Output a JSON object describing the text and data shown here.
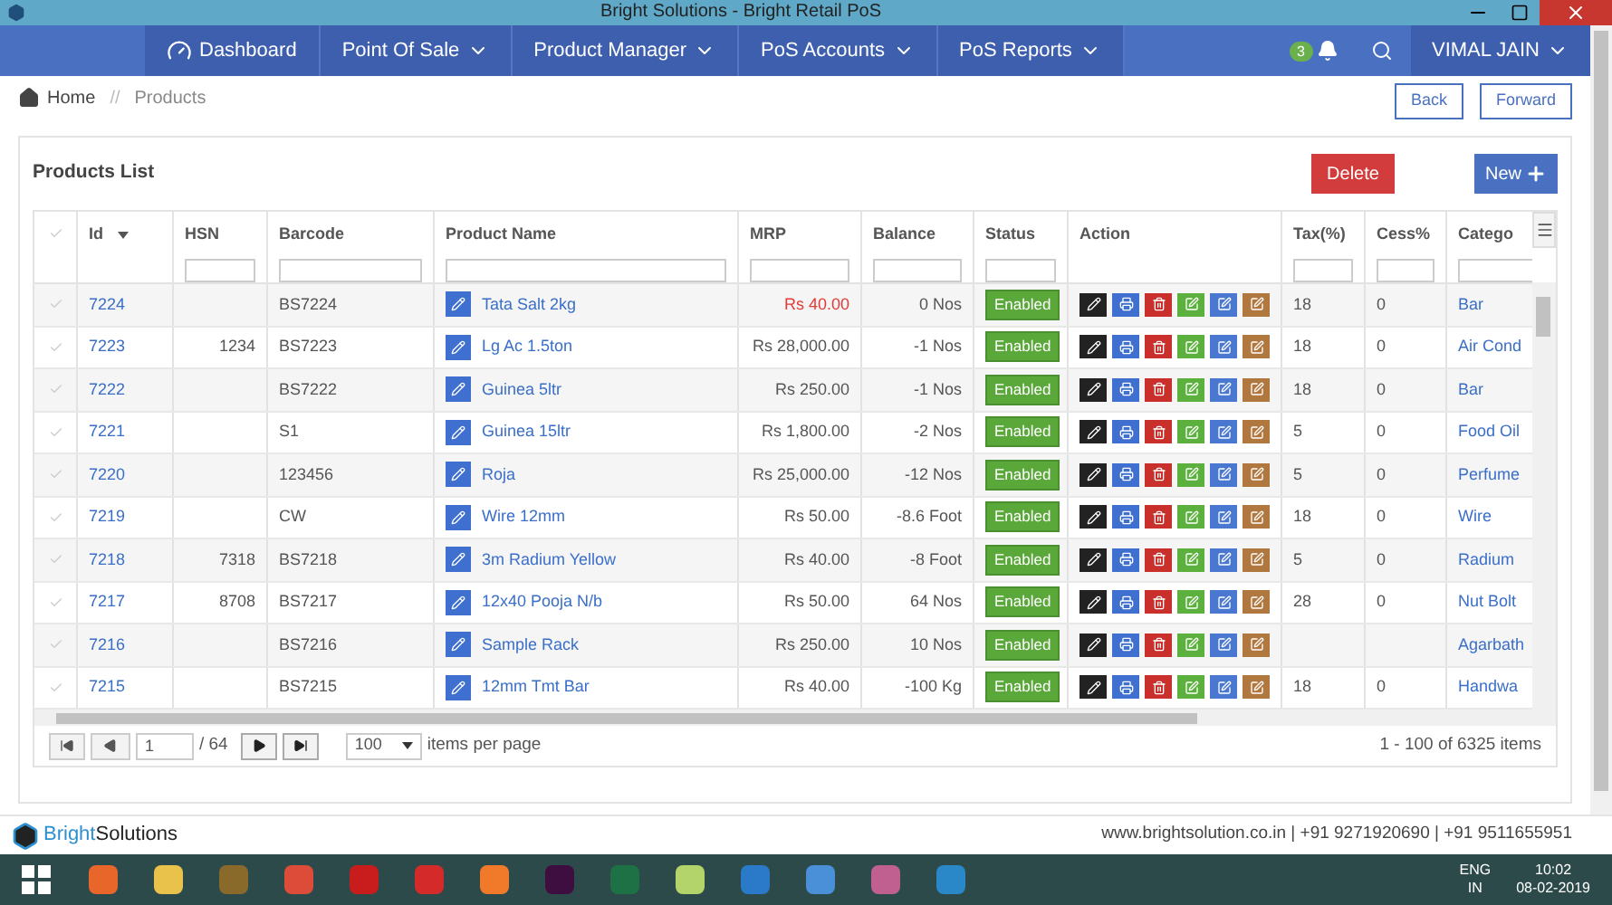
{
  "window": {
    "title": "Bright Solutions - Bright Retail PoS"
  },
  "nav": {
    "items": [
      {
        "label": "Dashboard",
        "kind": "icon"
      },
      {
        "label": "Point Of Sale",
        "kind": "dropdown"
      },
      {
        "label": "Product Manager",
        "kind": "dropdown"
      },
      {
        "label": "PoS Accounts",
        "kind": "dropdown"
      },
      {
        "label": "PoS Reports",
        "kind": "dropdown"
      }
    ],
    "notification_count": "3",
    "user": "VIMAL JAIN"
  },
  "breadcrumb": {
    "items": [
      "Home",
      "Products"
    ],
    "separator": "//"
  },
  "page_buttons": [
    "Back",
    "Forward"
  ],
  "card": {
    "title": "Products List",
    "delete_button": "Delete",
    "new_button": "New"
  },
  "table": {
    "columns": [
      {
        "label": "Id",
        "sorted": true,
        "filter": false
      },
      {
        "label": "HSN",
        "sorted": false,
        "filter": true
      },
      {
        "label": "Barcode",
        "sorted": false,
        "filter": true
      },
      {
        "label": "Product Name",
        "sorted": false,
        "filter": true
      },
      {
        "label": "MRP",
        "sorted": false,
        "filter": true
      },
      {
        "label": "Balance",
        "sorted": false,
        "filter": true
      },
      {
        "label": "Status",
        "sorted": false,
        "filter": true
      },
      {
        "label": "Action",
        "sorted": false,
        "filter": false
      },
      {
        "label": "Tax(%)",
        "sorted": false,
        "filter": true
      },
      {
        "label": "Cess%",
        "sorted": false,
        "filter": true
      },
      {
        "label": "Catego",
        "sorted": false,
        "filter": true
      }
    ],
    "actions": [
      {
        "kind": "pencil",
        "color": "#222222"
      },
      {
        "kind": "print",
        "color": "#3f6fcf"
      },
      {
        "kind": "trash",
        "color": "#c9302c"
      },
      {
        "kind": "edit",
        "color": "#5cb13e"
      },
      {
        "kind": "edit",
        "color": "#4a78d0"
      },
      {
        "kind": "edit",
        "color": "#b0773f"
      }
    ],
    "rows": [
      {
        "id": "7224",
        "hsn": "",
        "barcode": "BS7224",
        "name": "Tata Salt 2kg",
        "mrp": "Rs 40.00",
        "mrp_alert": true,
        "balance": "0 Nos",
        "status": "Enabled",
        "tax": "18",
        "cess": "0",
        "category": "Bar"
      },
      {
        "id": "7223",
        "hsn": "1234",
        "barcode": "BS7223",
        "name": "Lg Ac 1.5ton",
        "mrp": "Rs 28,000.00",
        "mrp_alert": false,
        "balance": "-1 Nos",
        "status": "Enabled",
        "tax": "18",
        "cess": "0",
        "category": "Air Cond"
      },
      {
        "id": "7222",
        "hsn": "",
        "barcode": "BS7222",
        "name": "Guinea 5ltr",
        "mrp": "Rs 250.00",
        "mrp_alert": false,
        "balance": "-1 Nos",
        "status": "Enabled",
        "tax": "18",
        "cess": "0",
        "category": "Bar"
      },
      {
        "id": "7221",
        "hsn": "",
        "barcode": "S1",
        "name": "Guinea 15ltr",
        "mrp": "Rs 1,800.00",
        "mrp_alert": false,
        "balance": "-2 Nos",
        "status": "Enabled",
        "tax": "5",
        "cess": "0",
        "category": "Food Oil"
      },
      {
        "id": "7220",
        "hsn": "",
        "barcode": "123456",
        "name": "Roja",
        "mrp": "Rs 25,000.00",
        "mrp_alert": false,
        "balance": "-12 Nos",
        "status": "Enabled",
        "tax": "5",
        "cess": "0",
        "category": "Perfume"
      },
      {
        "id": "7219",
        "hsn": "",
        "barcode": "CW",
        "name": "Wire 12mm",
        "mrp": "Rs 50.00",
        "mrp_alert": false,
        "balance": "-8.6 Foot",
        "status": "Enabled",
        "tax": "18",
        "cess": "0",
        "category": "Wire"
      },
      {
        "id": "7218",
        "hsn": "7318",
        "barcode": "BS7218",
        "name": "3m Radium Yellow",
        "mrp": "Rs 40.00",
        "mrp_alert": false,
        "balance": "-8 Foot",
        "status": "Enabled",
        "tax": "5",
        "cess": "0",
        "category": "Radium"
      },
      {
        "id": "7217",
        "hsn": "8708",
        "barcode": "BS7217",
        "name": "12x40 Pooja N/b",
        "mrp": "Rs 50.00",
        "mrp_alert": false,
        "balance": "64 Nos",
        "status": "Enabled",
        "tax": "28",
        "cess": "0",
        "category": "Nut Bolt"
      },
      {
        "id": "7216",
        "hsn": "",
        "barcode": "BS7216",
        "name": "Sample Rack",
        "mrp": "Rs 250.00",
        "mrp_alert": false,
        "balance": "10 Nos",
        "status": "Enabled",
        "tax": "",
        "cess": "",
        "category": "Agarbath"
      },
      {
        "id": "7215",
        "hsn": "",
        "barcode": "BS7215",
        "name": "12mm Tmt Bar",
        "mrp": "Rs 40.00",
        "mrp_alert": false,
        "balance": "-100 Kg",
        "status": "Enabled",
        "tax": "18",
        "cess": "0",
        "category": "Handwa"
      }
    ]
  },
  "pager": {
    "page": "1",
    "pages": "/ 64",
    "page_size": "100",
    "page_size_label": "items per page",
    "summary": "1 - 100 of 6325 items"
  },
  "footer": {
    "brand_part_1": "Bright",
    "brand_part_2": "Solutions",
    "contact": "www.brightsolution.co.in | +91 9271920690 | +91 9511655951"
  },
  "taskbar": {
    "language": "ENG",
    "region": "IN",
    "time": "10:02",
    "date": "08-02-2019"
  }
}
